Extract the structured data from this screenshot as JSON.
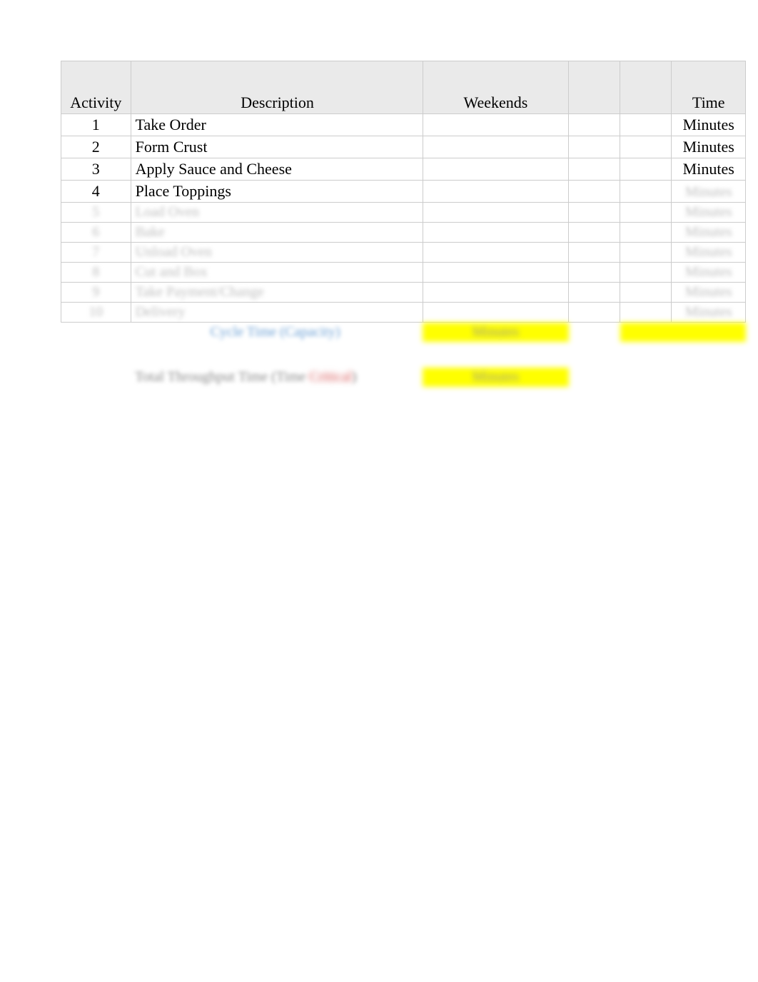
{
  "headers": {
    "activity": "Activity",
    "description": "Description",
    "weekends": "Weekends",
    "col_c1": "",
    "col_c2": "",
    "time": "Time"
  },
  "rows": [
    {
      "activity": "1",
      "description": "Take Order",
      "weekends": "",
      "c1": "",
      "c2": "",
      "time": "Minutes",
      "blurred": false
    },
    {
      "activity": "2",
      "description": "Form Crust",
      "weekends": "",
      "c1": "",
      "c2": "",
      "time": "Minutes",
      "blurred": false
    },
    {
      "activity": "3",
      "description": "Apply Sauce and Cheese",
      "weekends": "",
      "c1": "",
      "c2": "",
      "time": "Minutes",
      "blurred": false
    },
    {
      "activity": "4",
      "description": "Place Toppings",
      "weekends": "",
      "c1": "",
      "c2": "",
      "time": "Minutes",
      "blurred": false,
      "time_blurred": true
    },
    {
      "activity": "5",
      "description": "Load Oven",
      "weekends": "",
      "c1": "",
      "c2": "",
      "time": "Minutes",
      "blurred": true
    },
    {
      "activity": "6",
      "description": "Bake",
      "weekends": "",
      "c1": "",
      "c2": "",
      "time": "Minutes",
      "blurred": true
    },
    {
      "activity": "7",
      "description": "Unload Oven",
      "weekends": "",
      "c1": "",
      "c2": "",
      "time": "Minutes",
      "blurred": true
    },
    {
      "activity": "8",
      "description": "Cut and Box",
      "weekends": "",
      "c1": "",
      "c2": "",
      "time": "Minutes",
      "blurred": true
    },
    {
      "activity": "9",
      "description": "Take Payment/Change",
      "weekends": "",
      "c1": "",
      "c2": "",
      "time": "Minutes",
      "blurred": true
    },
    {
      "activity": "10",
      "description": "Delivery",
      "weekends": "",
      "c1": "",
      "c2": "",
      "time": "Minutes",
      "blurred": true
    }
  ],
  "summary1": {
    "label": "Cycle Time (Capacity)",
    "value": "Minutes",
    "extra": ""
  },
  "summary2": {
    "label_pre": "Total Throughput Time (Time ",
    "label_red": "Critical",
    "label_post": ")",
    "value": "Minutes"
  }
}
